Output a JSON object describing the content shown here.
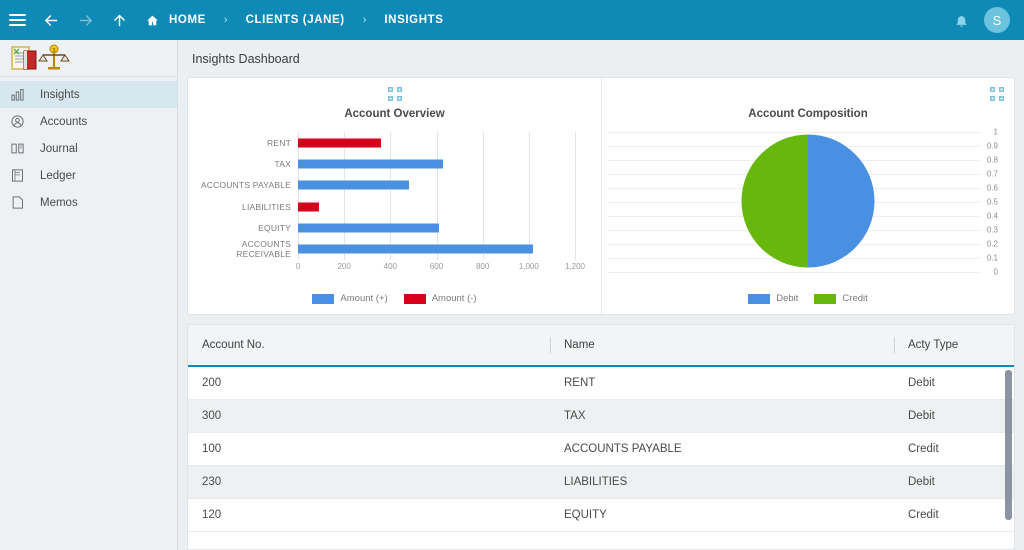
{
  "topbar": {
    "menu_icon": "hamburger-icon",
    "back_icon": "arrow-left-icon",
    "forward_icon": "arrow-right-icon",
    "up_icon": "arrow-up-icon",
    "home_icon": "home-icon",
    "bell_icon": "notification-bell-icon",
    "avatar_initial": "S",
    "breadcrumbs": [
      {
        "label": "HOME"
      },
      {
        "label": "CLIENTS (JANE)"
      },
      {
        "label": "INSIGHTS"
      }
    ],
    "separator": "›"
  },
  "sidebar": {
    "logo_icon": "ledger-scales-logo",
    "items": [
      {
        "label": "Insights",
        "icon": "insights-chart-icon",
        "active": true
      },
      {
        "label": "Accounts",
        "icon": "account-circle-icon",
        "active": false
      },
      {
        "label": "Journal",
        "icon": "open-book-icon",
        "active": false
      },
      {
        "label": "Ledger",
        "icon": "ledger-icon",
        "active": false
      },
      {
        "label": "Memos",
        "icon": "memo-page-icon",
        "active": false
      }
    ]
  },
  "page": {
    "title": "Insights Dashboard"
  },
  "cards": {
    "expand_icon": "expand-fullscreen-icon"
  },
  "colors": {
    "header_blue": "#0f89b5",
    "bar_positive": "#4a90e2",
    "bar_negative": "#d6001c",
    "pie_debit": "#4a90e2",
    "pie_credit": "#68b70d",
    "accent_underline": "#0f89b5"
  },
  "chart_data": [
    {
      "type": "bar",
      "orientation": "horizontal",
      "title": "Account Overview",
      "categories": [
        "RENT",
        "TAX",
        "ACCOUNTS PAYABLE",
        "LIABILITIES",
        "EQUITY",
        "ACCOUNTS RECEIVABLE"
      ],
      "values": [
        360,
        630,
        480,
        90,
        610,
        1020
      ],
      "sign": [
        "negative",
        "positive",
        "positive",
        "negative",
        "positive",
        "positive"
      ],
      "series": [
        {
          "name": "Amount (+)",
          "color": "#4a90e2"
        },
        {
          "name": "Amount (-)",
          "color": "#d6001c"
        }
      ],
      "legend": [
        "Amount (+)",
        "Amount (-)"
      ],
      "legend_position": "bottom",
      "xlabel": "",
      "ylabel": "",
      "xlim": [
        0,
        1200
      ],
      "xticks": [
        0,
        200,
        400,
        600,
        800,
        1000,
        1200
      ],
      "xticklabels": [
        "0",
        "200",
        "400",
        "600",
        "800",
        "1,000",
        "1,200"
      ],
      "grid": true
    },
    {
      "type": "pie",
      "title": "Account Composition",
      "labels": [
        "Debit",
        "Credit"
      ],
      "values": [
        0.5,
        0.5
      ],
      "colors": [
        "#4a90e2",
        "#68b70d"
      ],
      "legend": [
        "Debit",
        "Credit"
      ],
      "legend_position": "bottom",
      "axis_right_ticks": [
        "1",
        "0.9",
        "0.8",
        "0.7",
        "0.6",
        "0.5",
        "0.4",
        "0.3",
        "0.2",
        "0.1",
        "0"
      ],
      "grid": true
    }
  ],
  "table": {
    "columns": [
      "Account No.",
      "Name",
      "Acty Type"
    ],
    "rows": [
      {
        "account_no": "200",
        "name": "RENT",
        "acty_type": "Debit"
      },
      {
        "account_no": "300",
        "name": "TAX",
        "acty_type": "Debit"
      },
      {
        "account_no": "100",
        "name": "ACCOUNTS PAYABLE",
        "acty_type": "Credit"
      },
      {
        "account_no": "230",
        "name": "LIABILITIES",
        "acty_type": "Debit"
      },
      {
        "account_no": "120",
        "name": "EQUITY",
        "acty_type": "Credit"
      }
    ]
  }
}
